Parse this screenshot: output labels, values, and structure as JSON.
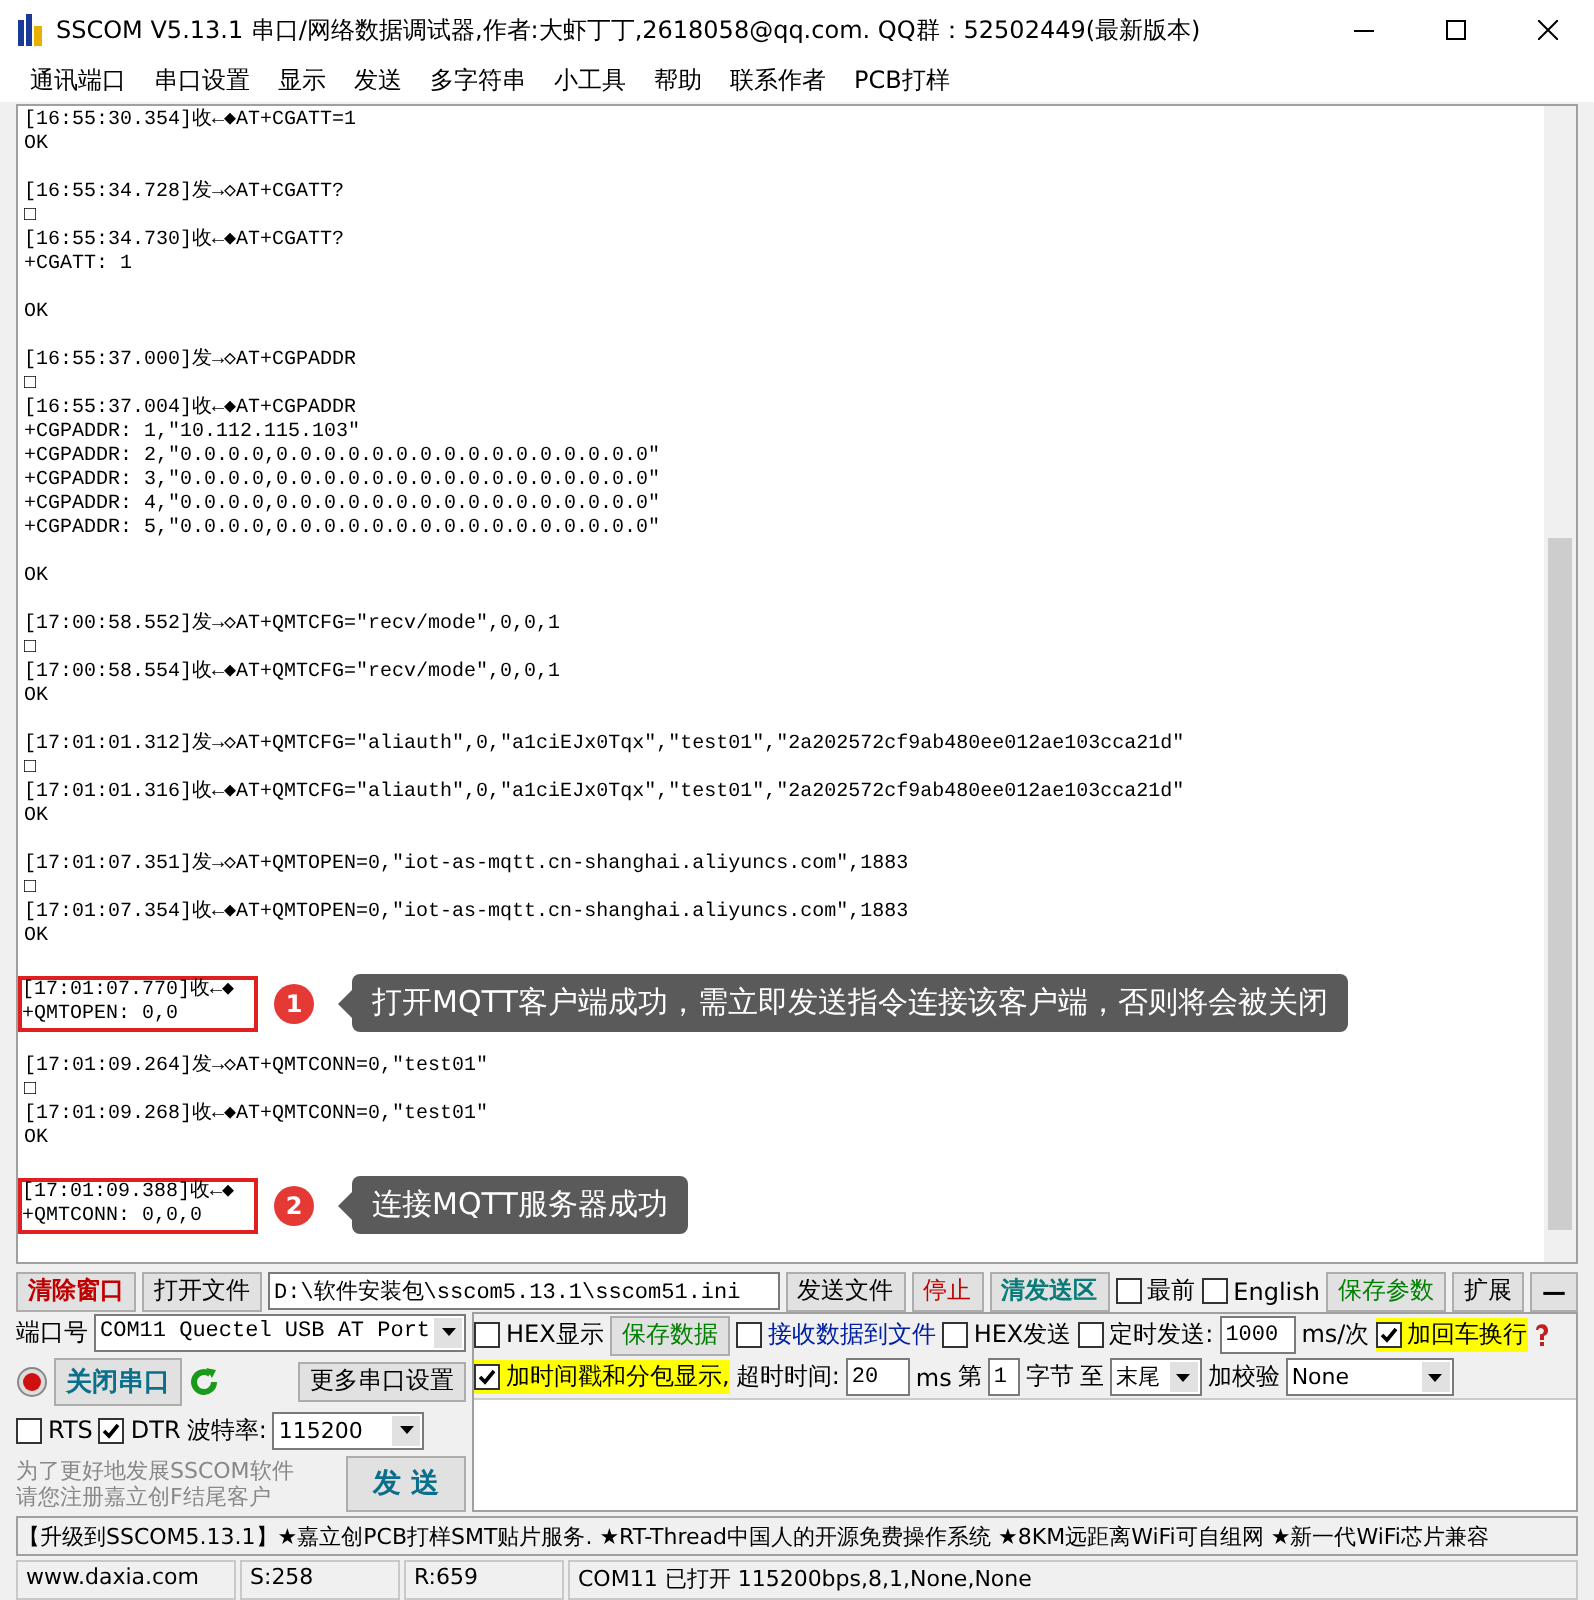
{
  "window": {
    "title": "SSCOM V5.13.1 串口/网络数据调试器,作者:大虾丁丁,2618058@qq.com. QQ群：52502449(最新版本)"
  },
  "menu": [
    "通讯端口",
    "串口设置",
    "显示",
    "发送",
    "多字符串",
    "小工具",
    "帮助",
    "联系作者",
    "PCB打样"
  ],
  "log": {
    "blocks": [
      {
        "highlighted": false,
        "lines": [
          "[16:55:30.354]收←◆AT+CGATT=1",
          "OK"
        ]
      },
      {
        "highlighted": false,
        "lines": [
          "[16:55:34.728]发→◇AT+CGATT?",
          "□",
          "[16:55:34.730]收←◆AT+CGATT?",
          "+CGATT: 1"
        ]
      },
      {
        "highlighted": false,
        "lines": [
          "OK"
        ]
      },
      {
        "highlighted": false,
        "lines": [
          "[16:55:37.000]发→◇AT+CGPADDR",
          "□",
          "[16:55:37.004]收←◆AT+CGPADDR",
          "+CGPADDR: 1,\"10.112.115.103\"",
          "+CGPADDR: 2,\"0.0.0.0,0.0.0.0.0.0.0.0.0.0.0.0.0.0.0.0\"",
          "+CGPADDR: 3,\"0.0.0.0,0.0.0.0.0.0.0.0.0.0.0.0.0.0.0.0\"",
          "+CGPADDR: 4,\"0.0.0.0,0.0.0.0.0.0.0.0.0.0.0.0.0.0.0.0\"",
          "+CGPADDR: 5,\"0.0.0.0,0.0.0.0.0.0.0.0.0.0.0.0.0.0.0.0\""
        ]
      },
      {
        "highlighted": false,
        "lines": [
          "OK"
        ]
      },
      {
        "highlighted": false,
        "lines": [
          "[17:00:58.552]发→◇AT+QMTCFG=\"recv/mode\",0,0,1",
          "□",
          "[17:00:58.554]收←◆AT+QMTCFG=\"recv/mode\",0,0,1",
          "OK"
        ]
      },
      {
        "highlighted": false,
        "lines": [
          "[17:01:01.312]发→◇AT+QMTCFG=\"aliauth\",0,\"a1ciEJx0Tqx\",\"test01\",\"2a202572cf9ab480ee012ae103cca21d\"",
          "□",
          "[17:01:01.316]收←◆AT+QMTCFG=\"aliauth\",0,\"a1ciEJx0Tqx\",\"test01\",\"2a202572cf9ab480ee012ae103cca21d\"",
          "OK"
        ]
      },
      {
        "highlighted": false,
        "lines": [
          "[17:01:07.351]发→◇AT+QMTOPEN=0,\"iot-as-mqtt.cn-shanghai.aliyuncs.com\",1883",
          "□",
          "[17:01:07.354]收←◆AT+QMTOPEN=0,\"iot-as-mqtt.cn-shanghai.aliyuncs.com\",1883",
          "OK"
        ]
      },
      {
        "highlighted": true,
        "lines": [
          "[17:01:07.770]收←◆",
          "+QMTOPEN: 0,0"
        ],
        "callout": {
          "number": "1",
          "text": "打开MQTT客户端成功，需立即发送指令连接该客户端，否则将会被关闭"
        }
      },
      {
        "highlighted": false,
        "lines": [
          "[17:01:09.264]发→◇AT+QMTCONN=0,\"test01\"",
          "□",
          "[17:01:09.268]收←◆AT+QMTCONN=0,\"test01\"",
          "OK"
        ]
      },
      {
        "highlighted": true,
        "lines": [
          "[17:01:09.388]收←◆",
          "+QMTCONN: 0,0,0"
        ],
        "callout": {
          "number": "2",
          "text": "连接MQTT服务器成功"
        }
      }
    ]
  },
  "toolbar": {
    "clear_button": "清除窗口",
    "open_file_button": "打开文件",
    "file_path": "D:\\软件安装包\\sscom5.13.1\\sscom51.ini",
    "send_file_button": "发送文件",
    "stop_button": "停止",
    "clear_send_button": "清发送区",
    "topmost": {
      "label": "最前",
      "checked": false
    },
    "english": {
      "label": "English",
      "checked": false
    },
    "save_params_button": "保存参数",
    "expand_button": "扩展",
    "collapse_button": "—"
  },
  "port": {
    "label": "端口号",
    "value": "COM11 Quectel USB AT Port",
    "close_button": "关闭串口",
    "more_button": "更多串口设置",
    "rts": {
      "label": "RTS",
      "checked": false
    },
    "dtr": {
      "label": "DTR",
      "checked": true
    },
    "baud_label": "波特率:",
    "baud": "115200",
    "notice": [
      "为了更好地发展SSCOM软件",
      "请您注册嘉立创F结尾客户"
    ],
    "send_button": "发 送"
  },
  "receive": {
    "hex_display": {
      "label": "HEX显示",
      "checked": false
    },
    "save_data_button": "保存数据",
    "to_file": {
      "label": "接收数据到文件",
      "checked": false
    },
    "hex_send": {
      "label": "HEX发送",
      "checked": false
    },
    "timed_send": {
      "label": "定时发送:",
      "checked": false
    },
    "interval": "1000",
    "interval_unit": "ms/次",
    "append_newline": {
      "label": "加回车换行",
      "checked": true
    },
    "timestamp": {
      "label": "加时间戳和分包显示,",
      "checked": true
    },
    "timeout_label": "超时时间:",
    "timeout": "20",
    "timeout_unit": "ms",
    "from_label": "第",
    "from": "1",
    "byte_label": "字节",
    "to_label": "至",
    "to": "末尾",
    "checksum_label": "加校验",
    "checksum": "None"
  },
  "ticker": "【升级到SSCOM5.13.1】★嘉立创PCB打样SMT贴片服务. ★RT-Thread中国人的开源免费操作系统 ★8KM远距离WiFi可自组网 ★新一代WiFi芯片兼容",
  "status_bar": [
    "www.daxia.com",
    "S:258",
    "R:659",
    "COM11 已打开  115200bps,8,1,None,None"
  ]
}
